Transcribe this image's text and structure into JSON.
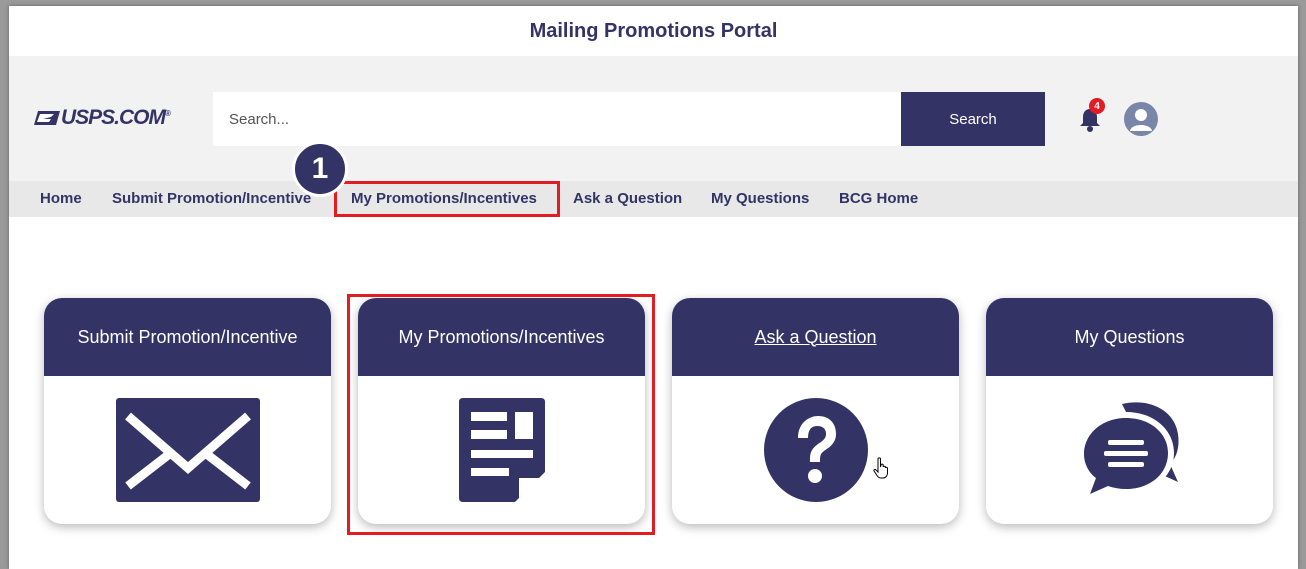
{
  "app": {
    "title": "Mailing Promotions Portal"
  },
  "header": {
    "logo_text": "USPS.COM",
    "logo_mark": "®",
    "search": {
      "placeholder": "Search...",
      "button_label": "Search"
    },
    "notifications": {
      "icon": "bell-icon",
      "count": "4"
    },
    "profile": {
      "icon": "user-avatar-icon"
    }
  },
  "step_marker": "1",
  "nav": {
    "items": [
      {
        "label": "Home"
      },
      {
        "label": "Submit Promotion/Incentive"
      },
      {
        "label": "My Promotions/Incentives",
        "highlighted": true
      },
      {
        "label": "Ask a Question"
      },
      {
        "label": "My Questions"
      },
      {
        "label": "BCG Home"
      }
    ]
  },
  "cards": [
    {
      "label": "Submit Promotion/Incentive",
      "icon": "envelope-icon"
    },
    {
      "label": "My Promotions/Incentives",
      "icon": "document-icon",
      "highlighted": true
    },
    {
      "label": "Ask a Question",
      "icon": "question-icon",
      "underlined": true
    },
    {
      "label": "My Questions",
      "icon": "chat-bubbles-icon"
    }
  ],
  "colors": {
    "primary": "#333366",
    "highlight": "#e31b23",
    "header_bg": "#f2f2f2",
    "nav_bg": "#e8e8e8"
  }
}
